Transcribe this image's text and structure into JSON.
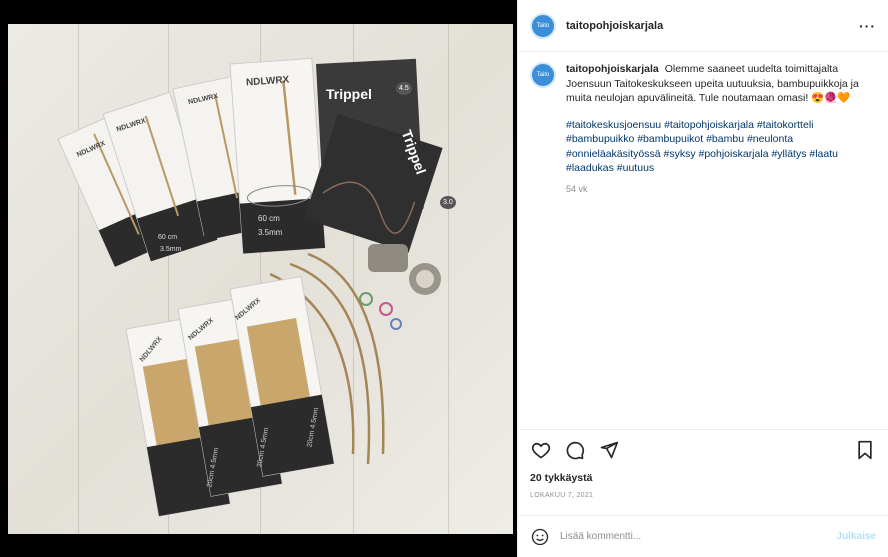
{
  "post": {
    "username": "taitopohjoiskarjala",
    "avatar_text": "Taito",
    "more_icon": "more-horizontal-icon",
    "caption_username": "taitopohjoiskarjala",
    "caption_text": "Olemme saaneet uudelta toimittajalta Joensuun Taitokeskukseen upeita uutuuksia, bambupuikkoja ja muita neulojan apuvälineitä. Tule noutamaan omasi! 😍🧶🧡",
    "hashtags": "#taitokeskusjoensuu #taitopohjoiskarjala #taitokortteli #bambupuikko #bambupuikot #bambu #neulonta #onnieläakäsityössä #syksy #pohjoiskarjala #yllätys #laatu #laadukas #uutuus",
    "age": "54 vk",
    "likes": "20 tykkäystä",
    "date": "LOKAKUU 7, 2021"
  },
  "actions": {
    "like_icon": "heart-icon",
    "comment_icon": "comment-icon",
    "share_icon": "send-icon",
    "save_icon": "bookmark-icon"
  },
  "comment_box": {
    "placeholder": "Lisää kommentti...",
    "post_label": "Julkaise",
    "emoji_icon": "emoji-icon"
  },
  "photo": {
    "labels": {
      "brand": "NDLWRX",
      "trippel": "Trippel",
      "size_45": "4.5",
      "size_30": "3.0",
      "len_60": "60 cm",
      "thick_35": "3.5mm",
      "dpn_a": "20cm 4.5mm",
      "dpn_b": "20cm 4.5mm",
      "dpn_c": "20cm 4.5mm"
    }
  },
  "colors": {
    "link": "#00376b",
    "muted": "#8e8e8e",
    "post_disabled": "#b2dffc",
    "avatar": "#3b8fd8"
  }
}
